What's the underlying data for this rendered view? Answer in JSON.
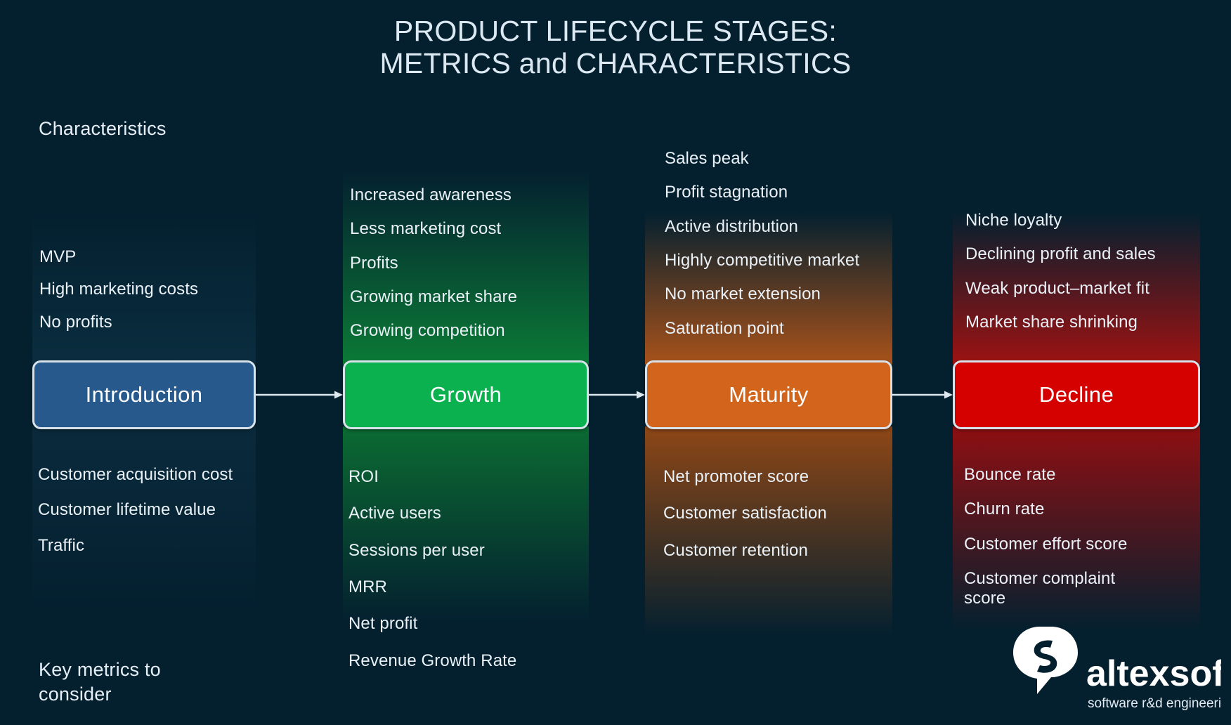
{
  "title": {
    "line1": "PRODUCT LIFECYCLE STAGES:",
    "line2": "METRICS and CHARACTERISTICS"
  },
  "labels": {
    "characteristics": "Characteristics",
    "key_metrics": "Key metrics to consider"
  },
  "colors": {
    "background": "#04202f",
    "introduction": "#27598c",
    "growth": "#0bb14f",
    "maturity": "#d2641b",
    "decline": "#d50000",
    "box_border": "#d7e2ea",
    "text": "#eaf1f7",
    "arrow": "#dde7ee"
  },
  "stages": [
    {
      "id": "introduction",
      "name": "Introduction",
      "accent": "#27598c",
      "characteristics": [
        "MVP",
        "High marketing costs",
        "No profits"
      ],
      "metrics": [
        "Customer acquisition cost",
        "Customer lifetime value",
        "Traffic"
      ]
    },
    {
      "id": "growth",
      "name": "Growth",
      "accent": "#0bb14f",
      "characteristics": [
        "Increased awareness",
        "Less marketing cost",
        "Profits",
        "Growing market share",
        "Growing competition"
      ],
      "metrics": [
        "ROI",
        "Active users",
        "Sessions per user",
        "MRR",
        "Net profit",
        "Revenue Growth Rate"
      ]
    },
    {
      "id": "maturity",
      "name": "Maturity",
      "accent": "#d2641b",
      "characteristics": [
        "Sales peak",
        "Profit stagnation",
        "Active distribution",
        "Highly competitive market",
        "No market extension",
        "Saturation point"
      ],
      "metrics": [
        "Net promoter score",
        "Customer satisfaction",
        "Customer retention"
      ]
    },
    {
      "id": "decline",
      "name": "Decline",
      "accent": "#d50000",
      "characteristics": [
        "Niche loyalty",
        "Declining profit and sales",
        "Weak product–market fit",
        "Market share shrinking"
      ],
      "metrics": [
        "Bounce rate",
        "Churn rate",
        "Customer effort score",
        "Customer complaint\nscore"
      ]
    }
  ],
  "arrows": [
    {
      "from": "introduction",
      "to": "growth"
    },
    {
      "from": "growth",
      "to": "maturity"
    },
    {
      "from": "maturity",
      "to": "decline"
    }
  ],
  "logo": {
    "wordmark": "altexsoft",
    "tagline": "software r&d engineering"
  }
}
